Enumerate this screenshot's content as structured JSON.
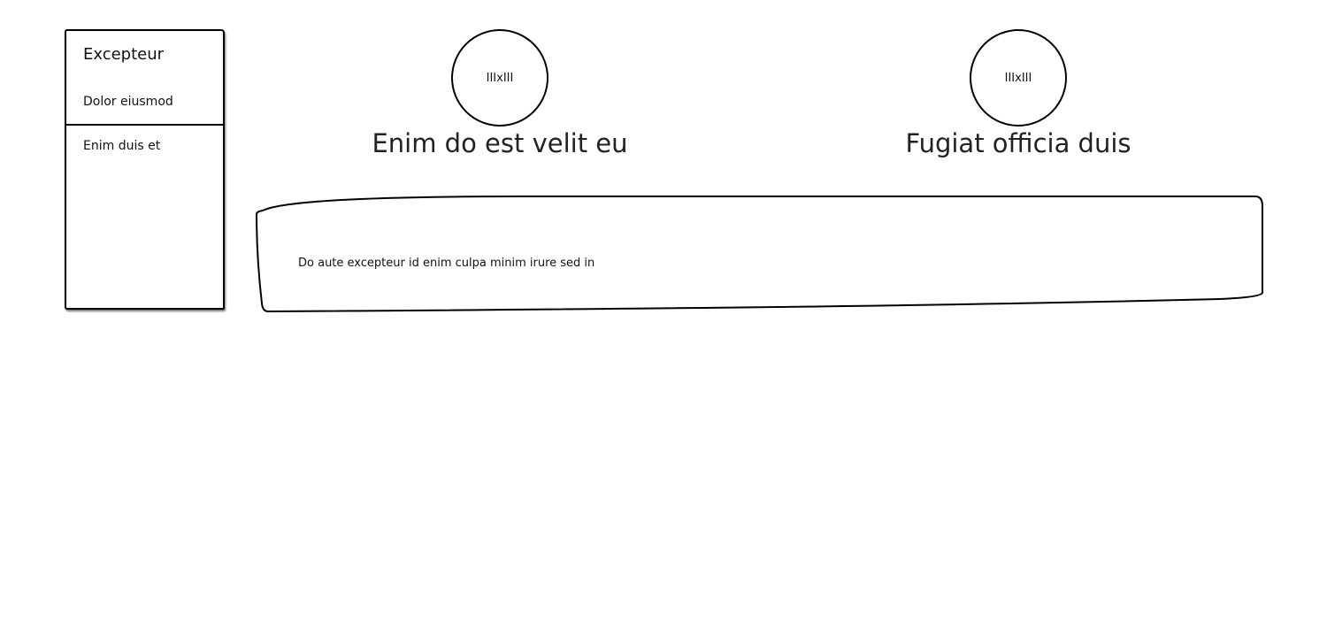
{
  "sidebar": {
    "title": "Excepteur",
    "items": [
      {
        "label": "Dolor eiusmod"
      },
      {
        "label": "Enim duis et"
      }
    ]
  },
  "profiles": [
    {
      "avatar_text": "IIIxIII",
      "name": "Enim do est velit eu"
    },
    {
      "avatar_text": "IIIxIII",
      "name": "Fugiat officia duis"
    }
  ],
  "panel": {
    "text": "Do aute excepteur id enim culpa minim irure sed in"
  }
}
